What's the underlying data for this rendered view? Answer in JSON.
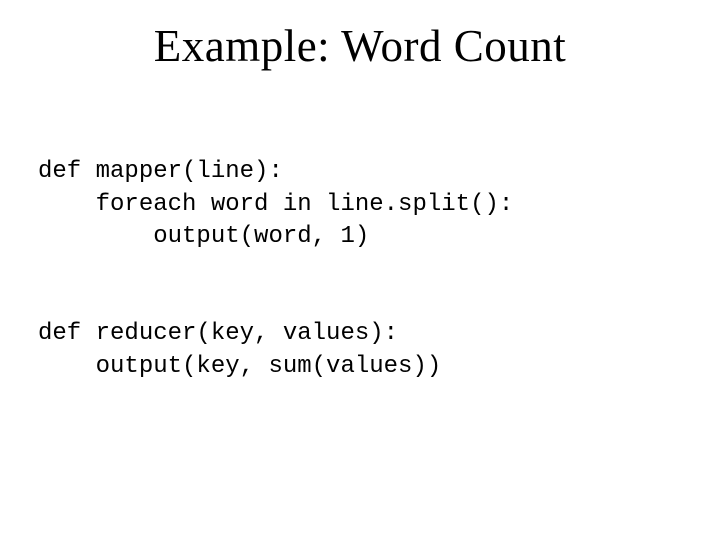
{
  "title": "Example: Word Count",
  "code": {
    "line1": "def mapper(line):",
    "line2": "    foreach word in line.split():",
    "line3": "        output(word, 1)",
    "line4": "",
    "line5": "",
    "line6": "def reducer(key, values):",
    "line7": "    output(key, sum(values))"
  }
}
